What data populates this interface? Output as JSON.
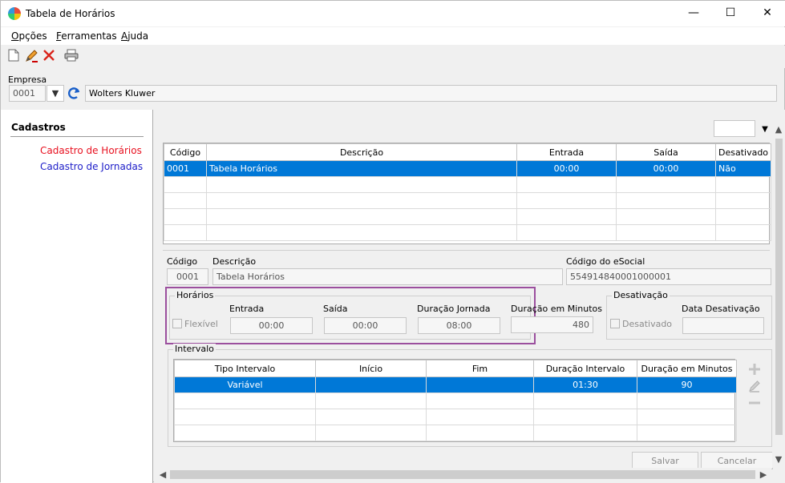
{
  "window": {
    "title": "Tabela de Horários",
    "minimize": "—",
    "maximize": "☐",
    "close": "✕"
  },
  "menu": [
    {
      "label": "Opções"
    },
    {
      "label": "Ferramentas"
    },
    {
      "label": "Ajuda"
    }
  ],
  "toolbar": {
    "new": "new-document-icon",
    "edit": "pencil-icon",
    "delete": "delete-x-icon",
    "print": "printer-icon"
  },
  "empresa": {
    "label": "Empresa",
    "code": "0001",
    "name": "Wolters Kluwer"
  },
  "sidebar": {
    "header": "Cadastros",
    "items": [
      {
        "label": "Cadastro de Horários",
        "color": "#e8101f"
      },
      {
        "label": "Cadastro de Jornadas",
        "color": "#1c1cc8"
      }
    ]
  },
  "grid": {
    "columns": [
      "Código",
      "Descrição",
      "Entrada",
      "Saída",
      "Desativado"
    ],
    "rows": [
      [
        "0001",
        "Tabela Horários",
        "00:00",
        "00:00",
        "Não"
      ]
    ]
  },
  "form": {
    "codigo_label": "Código",
    "codigo": "0001",
    "descricao_label": "Descrição",
    "descricao": "Tabela Horários",
    "esocial_label": "Código do eSocial",
    "esocial": "554914840001000001"
  },
  "horarios": {
    "title": "Horários",
    "flexivel": "Flexível",
    "entrada_label": "Entrada",
    "entrada": "00:00",
    "saida_label": "Saída",
    "saida": "00:00",
    "duracao_label": "Duração Jornada",
    "duracao": "08:00",
    "minutos_label": "Duração em Minutos",
    "minutos": "480"
  },
  "desativacao": {
    "title": "Desativação",
    "desativado": "Desativado",
    "data_label": "Data Desativação",
    "data": ""
  },
  "intervalo": {
    "title": "Intervalo",
    "columns": [
      "Tipo Intervalo",
      "Início",
      "Fim",
      "Duração Intervalo",
      "Duração em Minutos"
    ],
    "rows": [
      [
        "Variável",
        "",
        "",
        "01:30",
        "90"
      ]
    ]
  },
  "buttons": {
    "salvar": "Salvar",
    "cancelar": "Cancelar"
  },
  "accent": "#0078d7",
  "highlight": "#9b4f9e"
}
